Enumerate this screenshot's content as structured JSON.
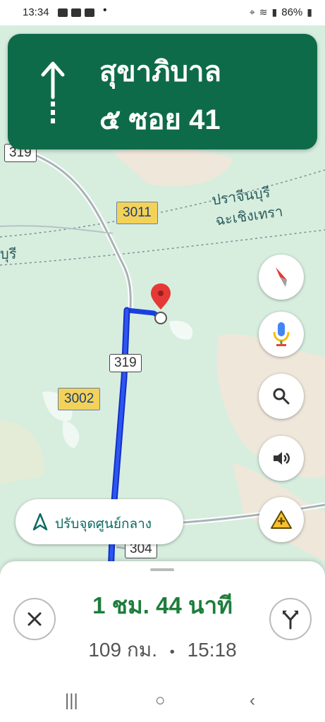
{
  "status_bar": {
    "time": "13:34",
    "battery": "86%",
    "icons": [
      "location-icon",
      "wifi-icon",
      "signal-icon",
      "battery-icon"
    ]
  },
  "direction_banner": {
    "street_line1": "สุขาภิบาล",
    "street_line2": "๕ ซอย 41",
    "icon": "straight-arrow-icon",
    "color": "#0e6b4a"
  },
  "map": {
    "road_labels": [
      "319",
      "319",
      "304"
    ],
    "route_numbers": [
      "3011",
      "3002"
    ],
    "places": [
      "ปราจีนบุรี",
      "ฉะเชิงเทรา",
      "บุรี"
    ],
    "route_color": "#1a3fe0"
  },
  "map_controls": {
    "compass": "compass-icon",
    "voice": "microphone-icon",
    "search": "search-icon",
    "sound": "speaker-icon",
    "report": "report-incident-icon"
  },
  "recenter": {
    "label": "ปรับจุดศูนย์กลาง"
  },
  "trip": {
    "duration": "1 ชม. 44 นาที",
    "distance": "109 กม.",
    "separator": "•",
    "arrival": "15:18"
  },
  "nav_bar": {
    "recent": "|||",
    "home": "○",
    "back": "‹"
  }
}
